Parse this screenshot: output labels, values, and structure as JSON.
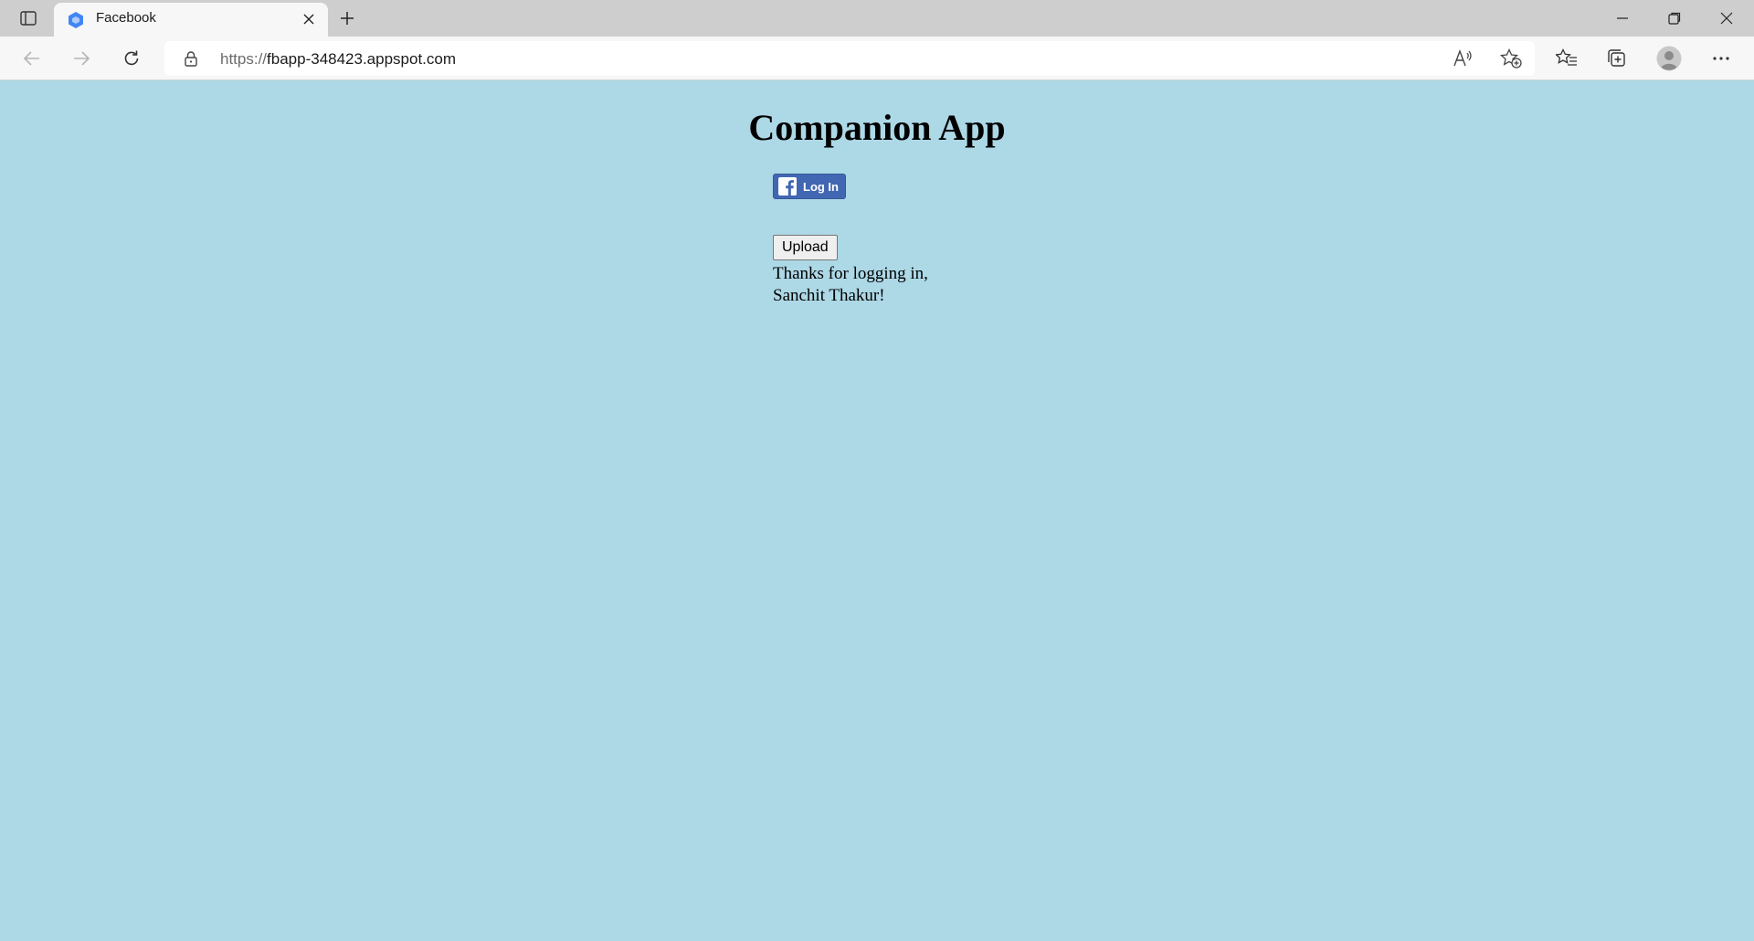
{
  "browser": {
    "tab": {
      "title": "Facebook",
      "favicon": "gcp-hexagon-icon"
    },
    "address": {
      "scheme": "https://",
      "host": "fbapp-348423.appspot.com"
    },
    "icons": {
      "tab_actions": "tab-actions-icon",
      "back": "back-arrow-icon",
      "forward": "forward-arrow-icon",
      "refresh": "refresh-icon",
      "lock": "lock-icon",
      "read_aloud": "read-aloud-icon",
      "add_favorite": "add-favorite-icon",
      "favorites": "favorites-icon",
      "collections": "collections-icon",
      "profile": "profile-avatar-icon",
      "more": "more-icon"
    },
    "colors": {
      "tabstrip": "#cecece",
      "toolbar": "#f7f7f7"
    }
  },
  "page": {
    "heading": "Companion App",
    "login_button": {
      "label": "Log In",
      "icon": "facebook-icon",
      "color": "#4267b2"
    },
    "upload_button": {
      "label": "Upload"
    },
    "message_line1": "Thanks for logging in,",
    "message_line2": "Sanchit Thakur!",
    "background": "#add8e6"
  }
}
